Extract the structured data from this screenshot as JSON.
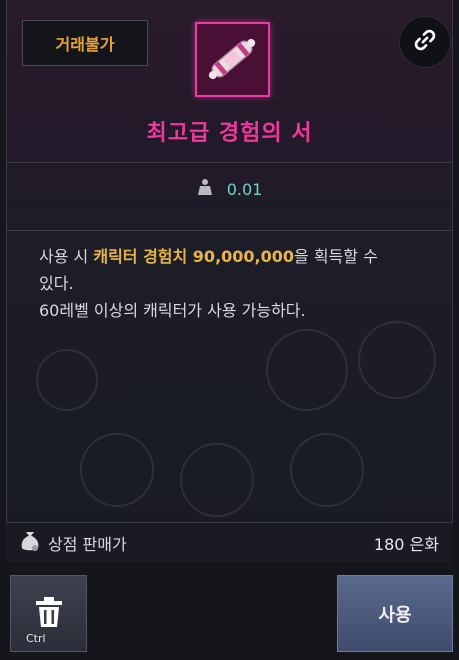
{
  "item": {
    "trade_badge": "거래불가",
    "title": "최고급 경험의 서",
    "weight": "0.01",
    "title_color": "#f0389a",
    "badge_color": "#e7a33a"
  },
  "description": {
    "line1_prefix": "사용 시 ",
    "line1_highlight": "캐릭터 경험치 90,000,000",
    "line1_suffix": "을 획득할 수",
    "line2": "있다.",
    "line3": "60레벨 이상의 캐릭터가 사용 가능하다.",
    "highlight_color": "#e9b54a"
  },
  "price": {
    "label": "상점 판매가",
    "value": "180 은화"
  },
  "actions": {
    "trash_hotkey": "Ctrl",
    "use_label": "사용"
  },
  "icons": {
    "link": "link-icon",
    "weight": "weight-icon",
    "money_bag": "money-bag-icon",
    "trash": "trash-icon",
    "item": "exp-scroll-icon"
  }
}
